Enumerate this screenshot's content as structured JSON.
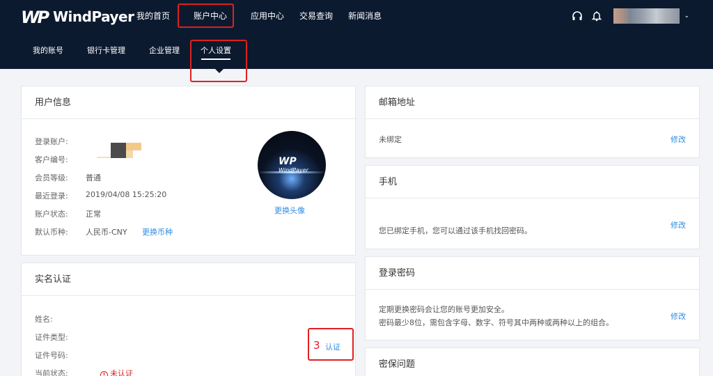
{
  "brand": {
    "logo_mark": "WP",
    "name": "WindPayer"
  },
  "main_nav": [
    {
      "label": "我的首页"
    },
    {
      "label": "账户中心",
      "active": true
    },
    {
      "label": "应用中心"
    },
    {
      "label": "交易查询"
    },
    {
      "label": "新闻消息"
    }
  ],
  "top_icons": [
    "headset-icon",
    "bell-icon",
    "chevron-down-icon"
  ],
  "sub_nav": [
    {
      "label": "我的账号"
    },
    {
      "label": "银行卡管理"
    },
    {
      "label": "企业管理"
    },
    {
      "label": "个人设置",
      "active": true
    }
  ],
  "user_info": {
    "title": "用户信息",
    "fields": [
      {
        "label": "登录账户:",
        "value": ""
      },
      {
        "label": "客户编号:",
        "value": ""
      },
      {
        "label": "会员等级:",
        "value": "普通"
      },
      {
        "label": "最近登录:",
        "value": "2019/04/08 15:25:20"
      },
      {
        "label": "账户状态:",
        "value": "正常"
      },
      {
        "label": "默认币种:",
        "value": "人民币-CNY"
      }
    ],
    "change_currency": "更换币种",
    "change_avatar": "更换头像",
    "avatar_logo": "WP",
    "avatar_name": "WindPayer"
  },
  "realname": {
    "title": "实名认证",
    "fields": [
      {
        "label": "姓名:"
      },
      {
        "label": "证件类型:"
      },
      {
        "label": "证件号码:"
      },
      {
        "label": "当前状态:"
      }
    ],
    "status": "未认证",
    "step_number": "3",
    "verify_link": "认证"
  },
  "email": {
    "title": "邮箱地址",
    "text": "未绑定",
    "action": "修改"
  },
  "phone": {
    "title": "手机",
    "text": "您已绑定手机，您可以通过该手机找回密码。",
    "action": "修改"
  },
  "password": {
    "title": "登录密码",
    "text1": "定期更换密码会让您的账号更加安全。",
    "text2": "密码最少8位，需包含字母、数字、符号其中两种或两种以上的组合。",
    "action": "修改"
  },
  "security_question": {
    "title": "密保问题"
  },
  "colors": {
    "topbar": "#0c1a2f",
    "link": "#2f8ee0",
    "annotation_red": "#e02020",
    "background": "#f2f4f7"
  }
}
